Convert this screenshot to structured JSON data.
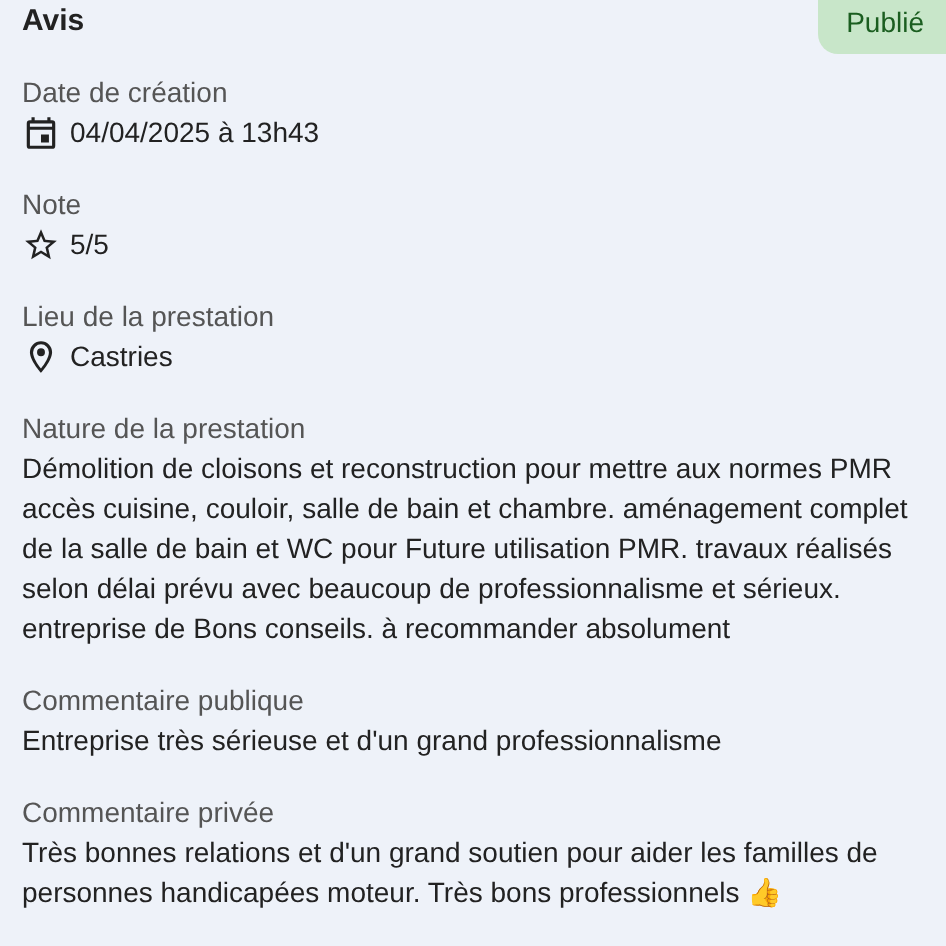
{
  "title": "Avis",
  "status_badge": "Publié",
  "fields": [
    {
      "kind": "date",
      "label": "Date de création",
      "value": "04/04/2025 à 13h43"
    },
    {
      "kind": "rating",
      "label": "Note",
      "value": "5/5"
    },
    {
      "kind": "place",
      "label": "Lieu de la prestation",
      "value": "Castries"
    },
    {
      "kind": "text",
      "label": "Nature de la prestation",
      "value": "Démolition de cloisons et reconstruction pour mettre aux normes PMR accès cuisine, couloir, salle de bain et chambre. aménagement complet de la salle de bain et WC pour Future utilisation PMR. travaux réalisés selon délai prévu avec beaucoup de professionnalisme et sérieux. entreprise de Bons conseils. à recommander absolument"
    },
    {
      "kind": "text",
      "label": "Commentaire publique",
      "value": "Entreprise très sérieuse et d'un grand professionnalisme"
    },
    {
      "kind": "text",
      "label": "Commentaire privée",
      "value": "Très bonnes relations et d'un grand soutien pour aider les familles de personnes handicapées moteur. Très bons professionnels 👍"
    }
  ]
}
